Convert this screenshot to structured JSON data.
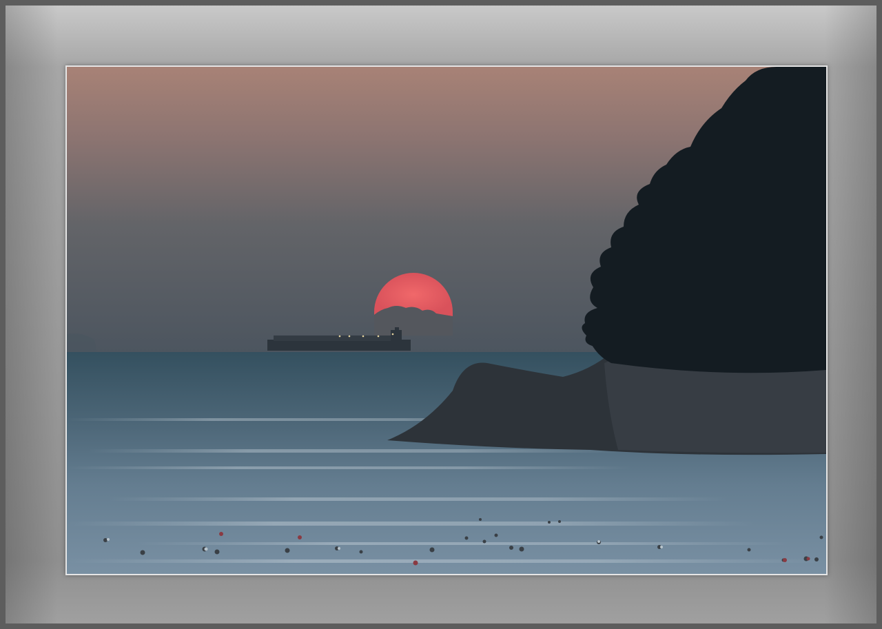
{
  "scene": {
    "subject": "sunset-over-sea-with-ship-and-rocky-island",
    "colors": {
      "sky_top": "#a78376",
      "sky_mid": "#6e6a6d",
      "sky_low": "#4f5760",
      "sun": "#e0575e",
      "sea_far": "#3c5566",
      "sea_near": "#6d8597",
      "rock": "#2b3035",
      "trees": "#141b21",
      "frame": "#9a9a9a"
    }
  }
}
